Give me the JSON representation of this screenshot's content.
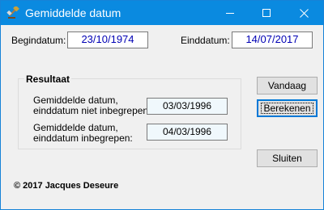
{
  "window": {
    "title": "Gemiddelde datum",
    "accent_color": "#0a8ae0",
    "icons": {
      "app": "gavel-icon",
      "minimize": "minimize-icon",
      "maximize": "maximize-icon",
      "close": "close-icon"
    }
  },
  "inputs": {
    "begindatum": {
      "label": "Begindatum:",
      "value": "23/10/1974"
    },
    "einddatum": {
      "label": "Einddatum:",
      "value": "14/07/2017"
    }
  },
  "result": {
    "group_title": "Resultaat",
    "excluded": {
      "label_line1": "Gemiddelde datum,",
      "label_line2": "einddatum niet inbegrepen:",
      "value": "03/03/1996"
    },
    "included": {
      "label_line1": "Gemiddelde datum,",
      "label_line2": "einddatum inbegrepen:",
      "value": "04/03/1996"
    }
  },
  "buttons": {
    "today": "Vandaag",
    "calculate": "Berekenen",
    "close": "Sluiten"
  },
  "footer": {
    "copyright": "© 2017 Jacques Deseure"
  }
}
